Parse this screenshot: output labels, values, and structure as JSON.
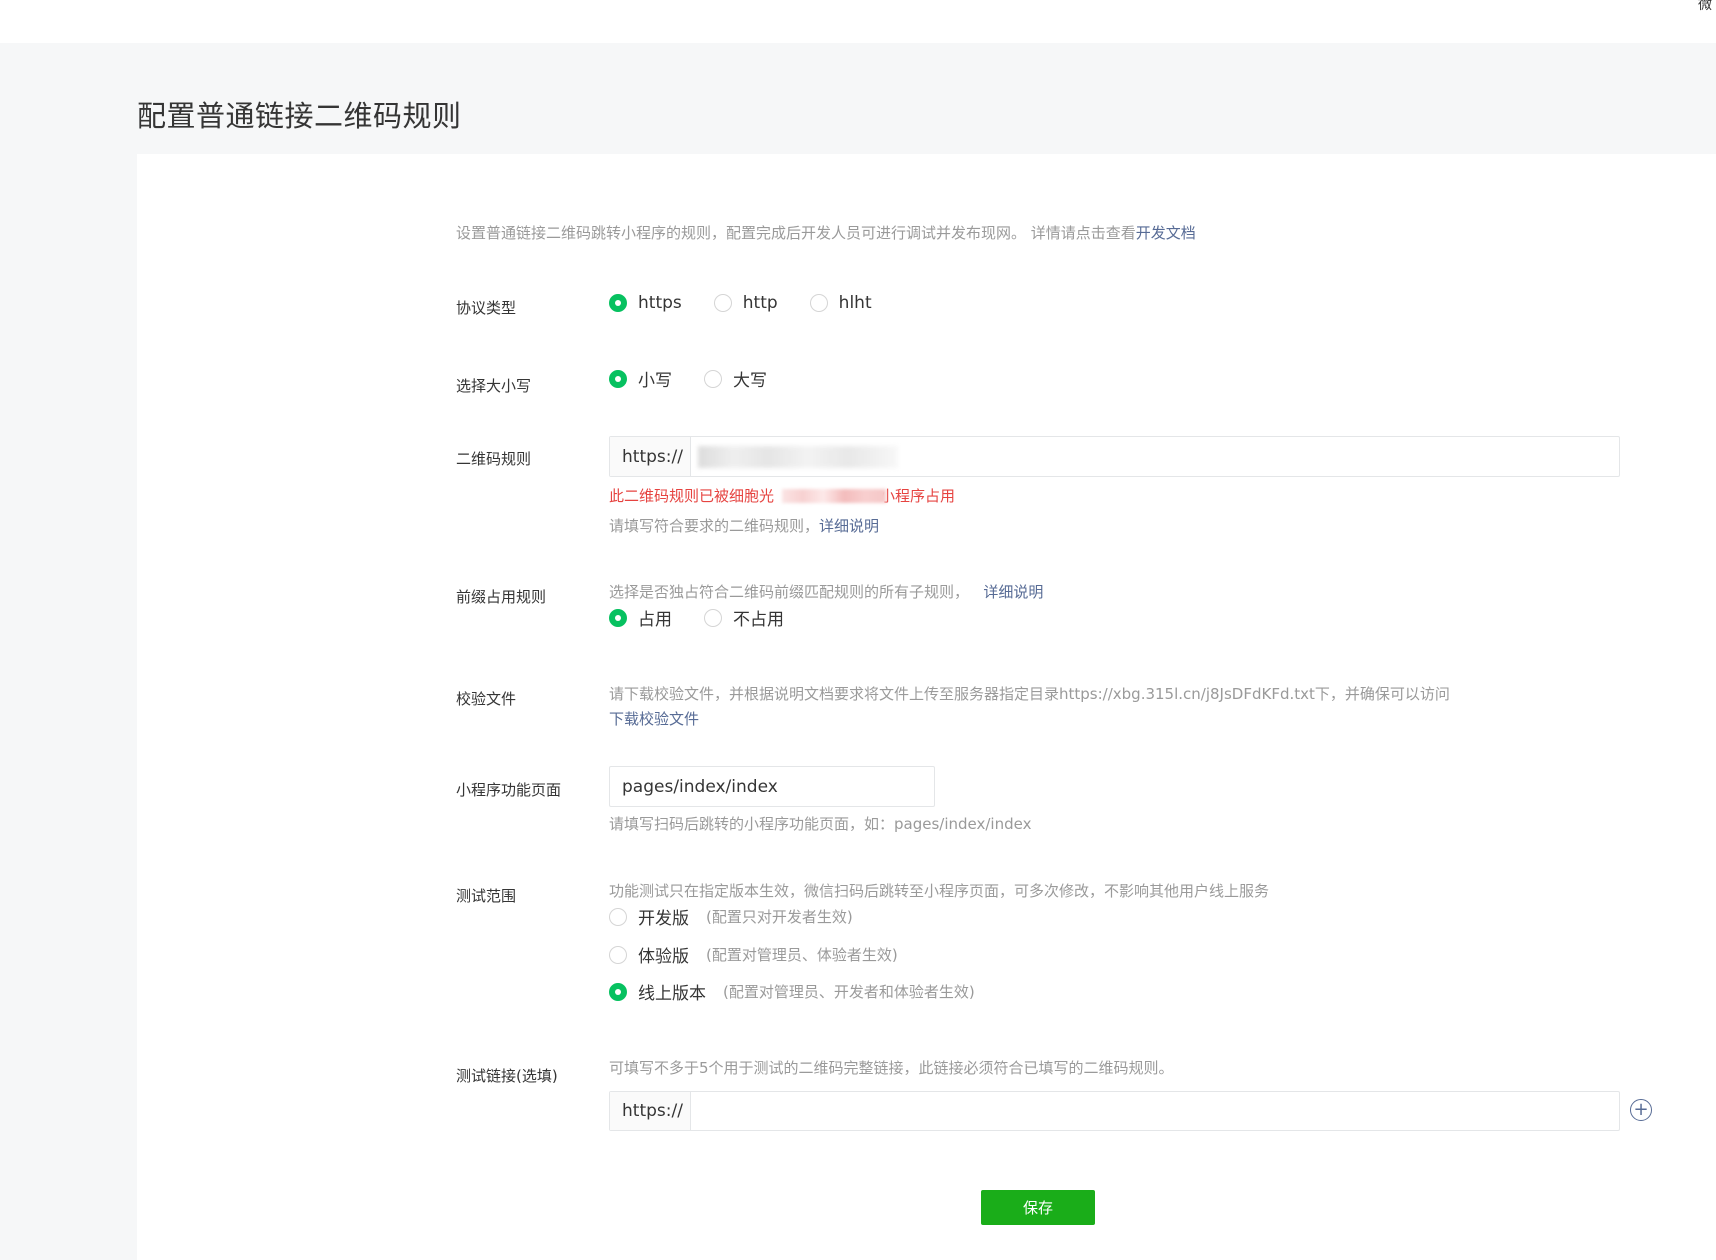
{
  "header": {
    "corner_text": "微"
  },
  "page": {
    "title": "配置普通链接二维码规则"
  },
  "intro": {
    "text": "设置普通链接二维码跳转小程序的规则，配置完成后开发人员可进行调试并发布现网。 详情请点击查看",
    "link": "开发文档"
  },
  "protocol": {
    "label": "协议类型",
    "options": [
      "https",
      "http",
      "hlht"
    ],
    "selected": "https"
  },
  "case": {
    "label": "选择大小写",
    "options": [
      "小写",
      "大写"
    ],
    "selected": "小写"
  },
  "qr_rule": {
    "label": "二维码规则",
    "prefix": "https://",
    "value": "",
    "error_start": "此二维码规则已被细胞光",
    "error_end": "小程序占用",
    "tip": "请填写符合要求的二维码规则，",
    "tip_link": "详细说明"
  },
  "prefix_rule": {
    "label": "前缀占用规则",
    "tip": "选择是否独占符合二维码前缀匹配规则的所有子规则，",
    "tip_link": "详细说明",
    "options": [
      "占用",
      "不占用"
    ],
    "selected": "占用"
  },
  "verify_file": {
    "label": "校验文件",
    "tip": "请下载校验文件，并根据说明文档要求将文件上传至服务器指定目录https://xbg.315l.cn/j8JsDFdKFd.txt下，并确保可以访问",
    "link": "下载校验文件"
  },
  "mini_page": {
    "label": "小程序功能页面",
    "value": "pages/index/index",
    "tip": "请填写扫码后跳转的小程序功能页面，如：pages/index/index"
  },
  "test_scope": {
    "label": "测试范围",
    "tip": "功能测试只在指定版本生效，微信扫码后跳转至小程序页面，可多次修改，不影响其他用户线上服务",
    "options": [
      {
        "label": "开发版",
        "note": "(配置只对开发者生效)"
      },
      {
        "label": "体验版",
        "note": "(配置对管理员、体验者生效)"
      },
      {
        "label": "线上版本",
        "note": "(配置对管理员、开发者和体验者生效)"
      }
    ],
    "selected": "线上版本"
  },
  "test_link": {
    "label": "测试链接(选填)",
    "tip": "可填写不多于5个用于测试的二维码完整链接，此链接必须符合已填写的二维码规则。",
    "prefix": "https://",
    "value": "",
    "add_icon": "plus-circle-icon"
  },
  "actions": {
    "save_label": "保存"
  },
  "colors": {
    "accent": "#07c160",
    "button": "#1aad19",
    "link": "#576b95",
    "error": "#e64340"
  }
}
